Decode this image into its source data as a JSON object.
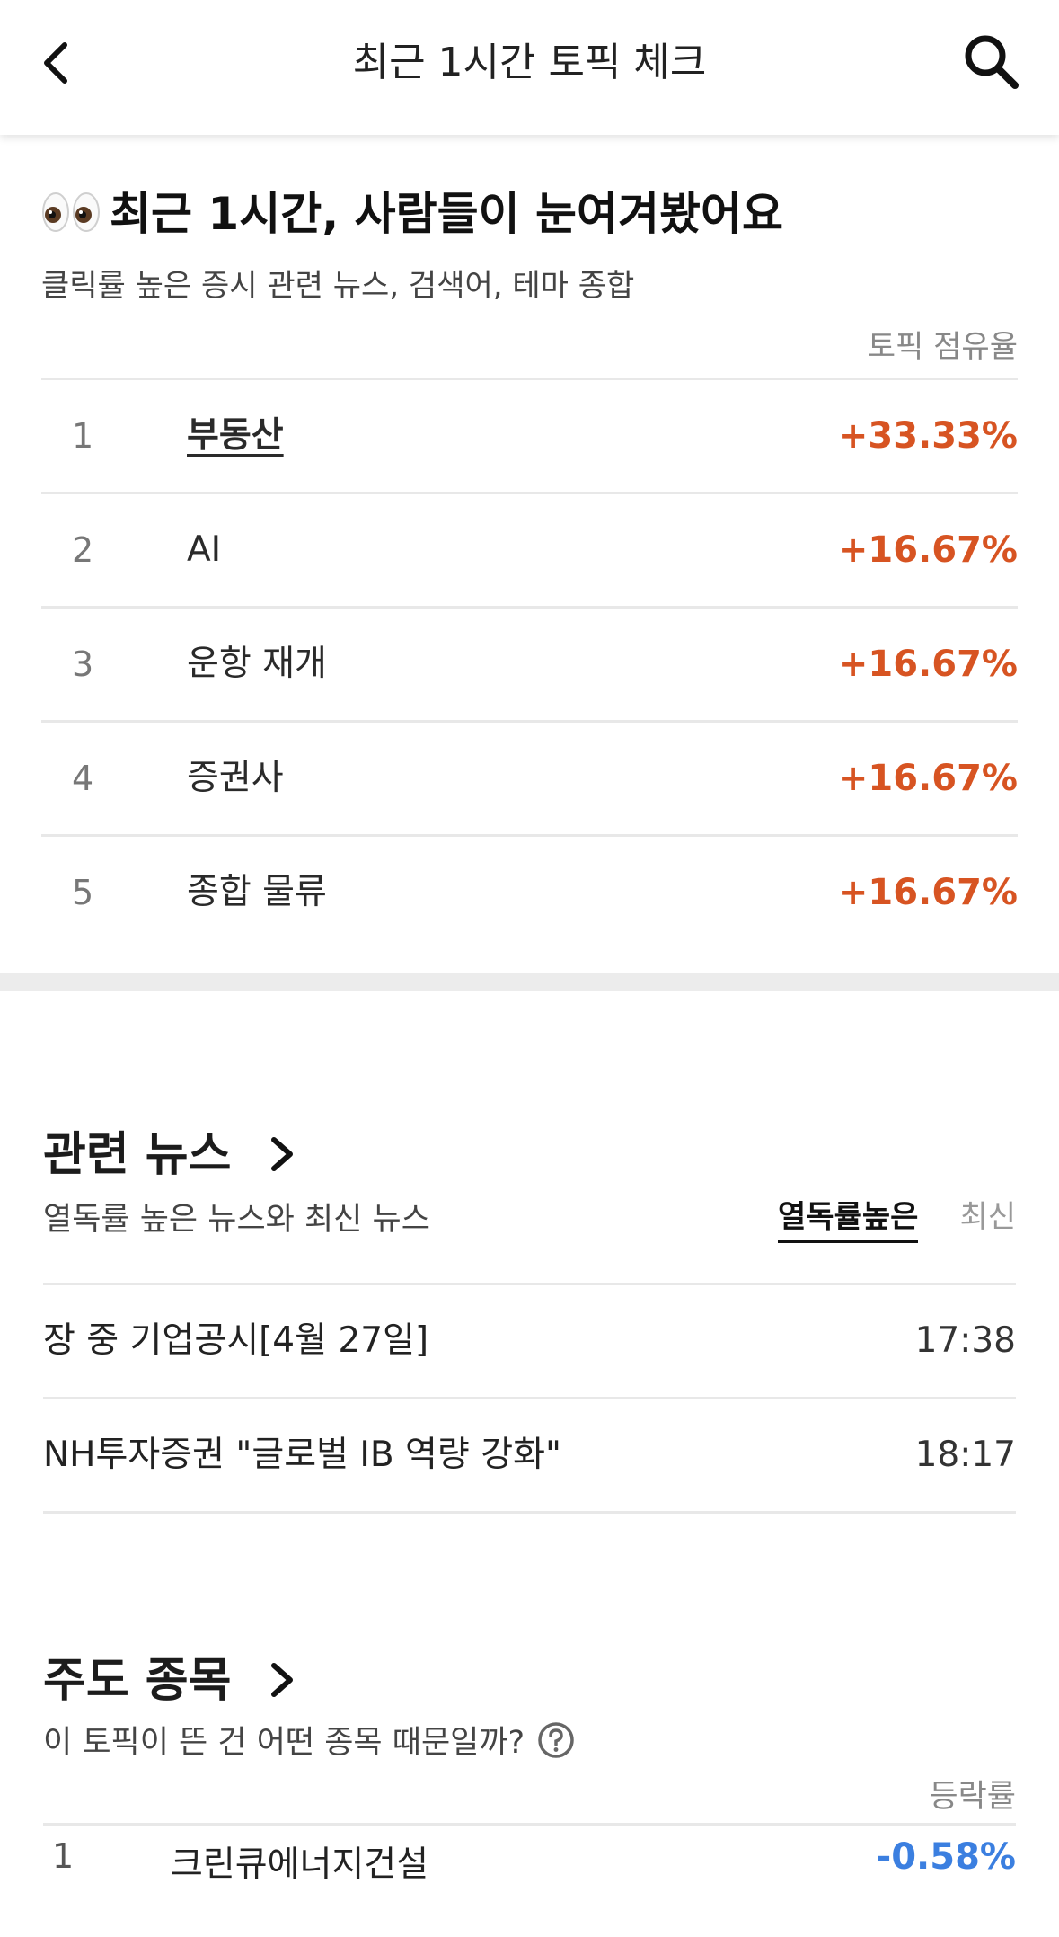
{
  "header": {
    "title": "최근 1시간 토픽 체크",
    "back_icon": "chevron-left-icon",
    "search_icon": "search-icon"
  },
  "hero": {
    "emoji_icon": "eyes-emoji-icon",
    "title": "최근 1시간, 사람들이 눈여겨봤어요",
    "subtitle": "클릭률 높은 증시 관련 뉴스, 검색어, 테마 종합",
    "share_column_label": "토픽 점유율"
  },
  "topics": [
    {
      "rank": "1",
      "name": "부동산",
      "share": "+33.33%"
    },
    {
      "rank": "2",
      "name": "AI",
      "share": "+16.67%"
    },
    {
      "rank": "3",
      "name": "운항 재개",
      "share": "+16.67%"
    },
    {
      "rank": "4",
      "name": "증권사",
      "share": "+16.67%"
    },
    {
      "rank": "5",
      "name": "종합 물류",
      "share": "+16.67%"
    }
  ],
  "news": {
    "title": "관련 뉴스",
    "subtitle": "열독률 높은 뉴스와 최신 뉴스",
    "tabs": [
      {
        "label": "열독률높은",
        "active": true
      },
      {
        "label": "최신",
        "active": false
      }
    ],
    "items": [
      {
        "headline": "장 중 기업공시[4월 27일]",
        "time": "17:38"
      },
      {
        "headline": "NH투자증권 \"글로벌 IB 역량 강화\"",
        "time": "18:17"
      }
    ]
  },
  "stocks": {
    "title": "주도 종목",
    "subtitle": "이 토픽이 뜬 건 어떤 종목 때문일까?",
    "help_icon": "question-circle-icon",
    "change_column_label": "등락률",
    "items": [
      {
        "rank": "1",
        "name": "크린큐에너지건설",
        "change": "-0.58%"
      }
    ]
  },
  "colors": {
    "accent_up": "#d75422",
    "accent_down": "#3b7fe0",
    "divider": "#e8e8e8",
    "section_gap": "#ececec"
  }
}
